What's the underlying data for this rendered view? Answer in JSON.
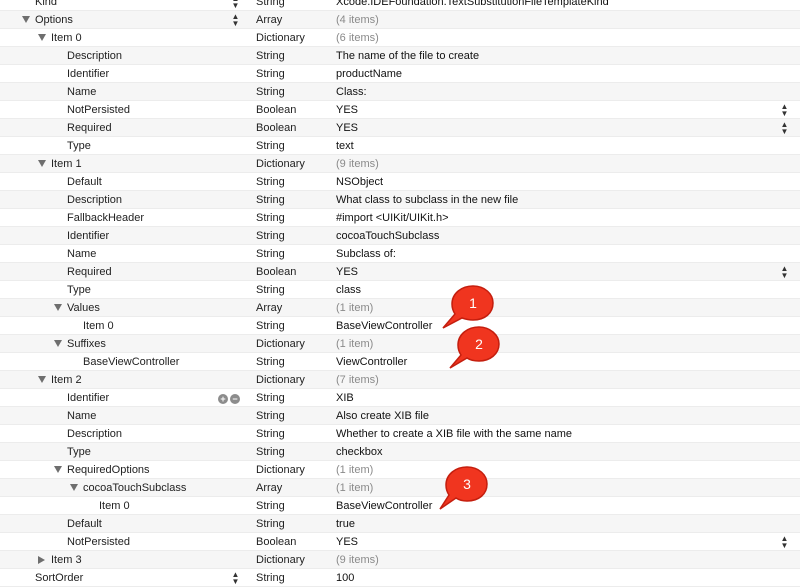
{
  "rows": [
    {
      "key": "Kind",
      "type": "String",
      "value": "Xcode.IDEFoundation.TextSubstitutionFileTemplateKind",
      "indent": 0,
      "tri": "none",
      "key_stepper": true
    },
    {
      "key": "Options",
      "type": "Array",
      "value": "(4 items)",
      "indent": 0,
      "tri": "open",
      "key_stepper": true,
      "muted": true
    },
    {
      "key": "Item 0",
      "type": "Dictionary",
      "value": "(6 items)",
      "indent": 1,
      "tri": "open",
      "muted": true
    },
    {
      "key": "Description",
      "type": "String",
      "value": "The name of the file to create",
      "indent": 2,
      "tri": "none"
    },
    {
      "key": "Identifier",
      "type": "String",
      "value": "productName",
      "indent": 2,
      "tri": "none"
    },
    {
      "key": "Name",
      "type": "String",
      "value": "Class:",
      "indent": 2,
      "tri": "none"
    },
    {
      "key": "NotPersisted",
      "type": "Boolean",
      "value": "YES",
      "indent": 2,
      "tri": "none",
      "value_stepper": true
    },
    {
      "key": "Required",
      "type": "Boolean",
      "value": "YES",
      "indent": 2,
      "tri": "none",
      "value_stepper": true
    },
    {
      "key": "Type",
      "type": "String",
      "value": "text",
      "indent": 2,
      "tri": "none"
    },
    {
      "key": "Item 1",
      "type": "Dictionary",
      "value": "(9 items)",
      "indent": 1,
      "tri": "open",
      "muted": true
    },
    {
      "key": "Default",
      "type": "String",
      "value": "NSObject",
      "indent": 2,
      "tri": "none"
    },
    {
      "key": "Description",
      "type": "String",
      "value": "What class to subclass in the new file",
      "indent": 2,
      "tri": "none"
    },
    {
      "key": "FallbackHeader",
      "type": "String",
      "value": "#import <UIKit/UIKit.h>",
      "indent": 2,
      "tri": "none"
    },
    {
      "key": "Identifier",
      "type": "String",
      "value": "cocoaTouchSubclass",
      "indent": 2,
      "tri": "none"
    },
    {
      "key": "Name",
      "type": "String",
      "value": "Subclass of:",
      "indent": 2,
      "tri": "none"
    },
    {
      "key": "Required",
      "type": "Boolean",
      "value": "YES",
      "indent": 2,
      "tri": "none",
      "value_stepper": true
    },
    {
      "key": "Type",
      "type": "String",
      "value": "class",
      "indent": 2,
      "tri": "none"
    },
    {
      "key": "Values",
      "type": "Array",
      "value": "(1 item)",
      "indent": 2,
      "tri": "open",
      "muted": true
    },
    {
      "key": "Item 0",
      "type": "String",
      "value": "BaseViewController",
      "indent": 3,
      "tri": "none"
    },
    {
      "key": "Suffixes",
      "type": "Dictionary",
      "value": "(1 item)",
      "indent": 2,
      "tri": "open",
      "muted": true
    },
    {
      "key": "BaseViewController",
      "type": "String",
      "value": "ViewController",
      "indent": 3,
      "tri": "none"
    },
    {
      "key": "Item 2",
      "type": "Dictionary",
      "value": "(7 items)",
      "indent": 1,
      "tri": "open",
      "muted": true
    },
    {
      "key": "Identifier",
      "type": "String",
      "value": "XIB",
      "indent": 2,
      "tri": "none",
      "addrem": true
    },
    {
      "key": "Name",
      "type": "String",
      "value": "Also create XIB file",
      "indent": 2,
      "tri": "none"
    },
    {
      "key": "Description",
      "type": "String",
      "value": "Whether to create a XIB file with the same name",
      "indent": 2,
      "tri": "none"
    },
    {
      "key": "Type",
      "type": "String",
      "value": "checkbox",
      "indent": 2,
      "tri": "none"
    },
    {
      "key": "RequiredOptions",
      "type": "Dictionary",
      "value": "(1 item)",
      "indent": 2,
      "tri": "open",
      "muted": true
    },
    {
      "key": "cocoaTouchSubclass",
      "type": "Array",
      "value": "(1 item)",
      "indent": 3,
      "tri": "open",
      "muted": true
    },
    {
      "key": "Item 0",
      "type": "String",
      "value": "BaseViewController",
      "indent": 4,
      "tri": "none"
    },
    {
      "key": "Default",
      "type": "String",
      "value": "true",
      "indent": 2,
      "tri": "none"
    },
    {
      "key": "NotPersisted",
      "type": "Boolean",
      "value": "YES",
      "indent": 2,
      "tri": "none",
      "value_stepper": true
    },
    {
      "key": "Item 3",
      "type": "Dictionary",
      "value": "(9 items)",
      "indent": 1,
      "tri": "closed",
      "muted": true
    },
    {
      "key": "SortOrder",
      "type": "String",
      "value": "100",
      "indent": 0,
      "tri": "none",
      "key_stepper": true
    }
  ],
  "annotations": [
    {
      "label": "1"
    },
    {
      "label": "2"
    },
    {
      "label": "3"
    }
  ],
  "colors": {
    "bubble_fill": "#f0351f",
    "bubble_stroke": "#c41e0e",
    "row_alt": "#f6f6f6"
  }
}
